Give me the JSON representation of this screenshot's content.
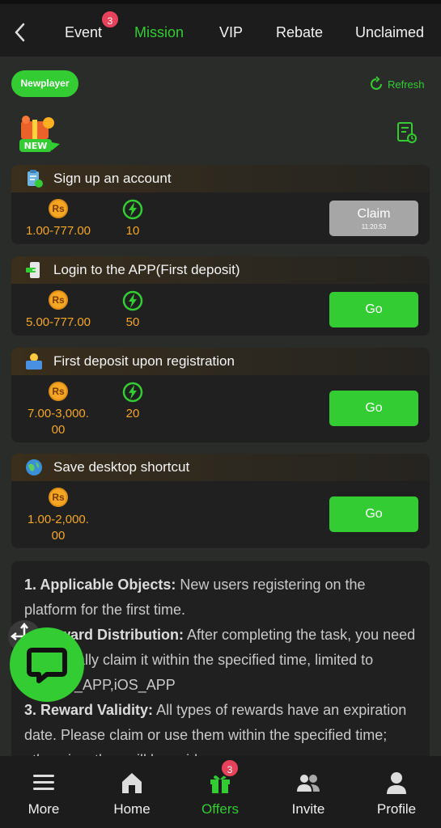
{
  "header": {
    "tabs": [
      {
        "label": "Event",
        "badge": "3"
      },
      {
        "label": "Mission",
        "active": true
      },
      {
        "label": "VIP"
      },
      {
        "label": "Rebate"
      },
      {
        "label": "Unclaimed"
      }
    ]
  },
  "toolbar": {
    "newplayer_label": "Newplayer",
    "refresh_label": "Refresh",
    "new_tag": "NEW"
  },
  "tasks": [
    {
      "title": "Sign up an account",
      "currency": "Rs",
      "amount": "1.00-777.00",
      "points": "10",
      "action": "Claim",
      "timer": "11:20:53"
    },
    {
      "title": "Login to the APP(First deposit)",
      "currency": "Rs",
      "amount": "5.00-777.00",
      "points": "50",
      "action": "Go"
    },
    {
      "title": "First deposit upon registration",
      "currency": "Rs",
      "amount_line1": "7.00-3,000.",
      "amount_line2": "00",
      "points": "20",
      "action": "Go"
    },
    {
      "title": "Save desktop shortcut",
      "currency": "Rs",
      "amount_line1": "1.00-2,000.",
      "amount_line2": "00",
      "action": "Go"
    }
  ],
  "rules": {
    "r1_head": "1. Applicable Objects:",
    "r1_body": " New users registering on the platform for the first time.",
    "r2_head": "2. Reward Distribution:",
    "r2_body": " After completing the task, you need to manually claim it within the specified time, limited to Android_APP,iOS_APP",
    "r3_head": "3. Reward Validity:",
    "r3_body": " All types of rewards have an expiration date. Please claim or use them within the specified time; otherwise, they will be void."
  },
  "bottom_nav": {
    "items": [
      {
        "label": "More"
      },
      {
        "label": "Home"
      },
      {
        "label": "Offers",
        "badge": "3",
        "active": true
      },
      {
        "label": "Invite"
      },
      {
        "label": "Profile"
      }
    ]
  },
  "colors": {
    "accent": "#33cc33",
    "gold": "#f5a623",
    "badge": "#e8415b",
    "background": "#2a2c2a"
  }
}
